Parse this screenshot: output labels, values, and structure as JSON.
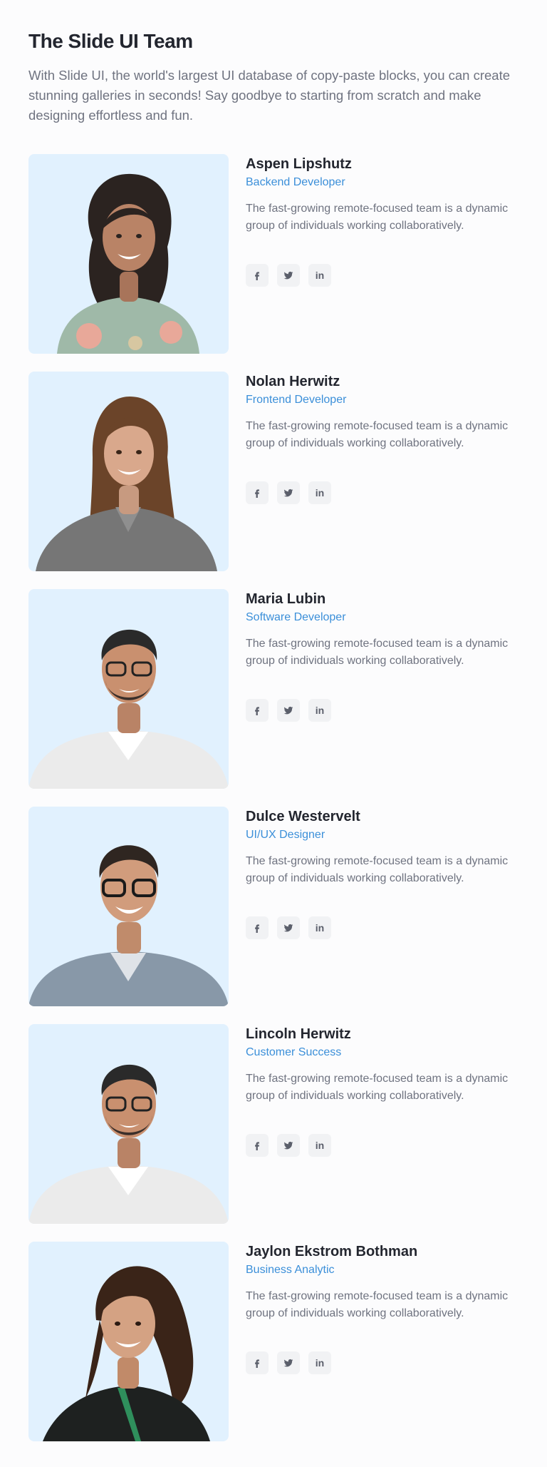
{
  "header": {
    "title": "The Slide UI Team",
    "subtitle": "With Slide UI, the world's largest UI database of copy-paste blocks, you can create stunning galleries in seconds! Say goodbye to starting from scratch and make designing effortless and fun."
  },
  "colors": {
    "photo_bg": "#e1f1fe",
    "role": "#3b8fd9",
    "social_bg": "#f1f2f4",
    "social_icon": "#5b5f6b"
  },
  "social_icons": [
    "facebook-icon",
    "twitter-icon",
    "linkedin-icon"
  ],
  "members": [
    {
      "name": "Aspen Lipshutz",
      "role": "Backend Developer",
      "bio": "The fast-growing remote-focused team is a dynamic group of individuals working collaboratively."
    },
    {
      "name": "Nolan Herwitz",
      "role": "Frontend Developer",
      "bio": "The fast-growing remote-focused team is a dynamic group of individuals working collaboratively."
    },
    {
      "name": "Maria Lubin",
      "role": "Software Developer",
      "bio": "The fast-growing remote-focused team is a dynamic group of individuals working collaboratively."
    },
    {
      "name": "Dulce Westervelt",
      "role": "UI/UX Designer",
      "bio": "The fast-growing remote-focused team is a dynamic group of individuals working collaboratively."
    },
    {
      "name": "Lincoln Herwitz",
      "role": "Customer Success",
      "bio": "The fast-growing remote-focused team is a dynamic group of individuals working collaboratively."
    },
    {
      "name": "Jaylon Ekstrom Bothman",
      "role": "Business Analytic",
      "bio": "The fast-growing remote-focused team is a dynamic group of individuals working collaboratively."
    }
  ]
}
